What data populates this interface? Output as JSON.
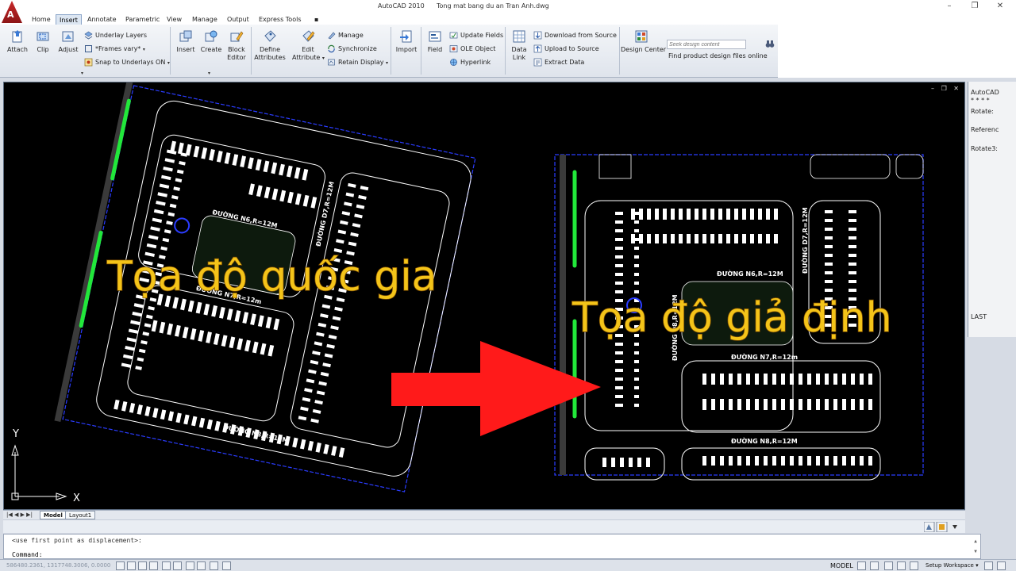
{
  "window": {
    "title": "AutoCAD 2010      Tong mat bang du an Tran Anh.dwg",
    "minimize": "–",
    "restore": "❐",
    "close": "✕",
    "logo_letter": "A"
  },
  "tabs": [
    {
      "label": "Home"
    },
    {
      "label": "Insert"
    },
    {
      "label": "Annotate"
    },
    {
      "label": "Parametric"
    },
    {
      "label": "View"
    },
    {
      "label": "Manage"
    },
    {
      "label": "Output"
    },
    {
      "label": "Express Tools"
    },
    {
      "label": "▪"
    }
  ],
  "active_tab": "Insert",
  "ribbon": {
    "attach": "Attach",
    "clip": "Clip",
    "adjust": "Adjust",
    "underlay_layers": "Underlay Layers",
    "frames_vary": "*Frames vary*",
    "snap_to_underlays": "Snap to Underlays ON",
    "insert": "Insert",
    "create": "Create",
    "block_editor_1": "Block",
    "block_editor_2": "Editor",
    "define_attributes_1": "Define",
    "define_attributes_2": "Attributes",
    "edit_attribute_1": "Edit",
    "edit_attribute_2": "Attribute",
    "manage": "Manage",
    "synchronize": "Synchronize",
    "retain_display": "Retain Display",
    "import": "Import",
    "field": "Field",
    "update_fields": "Update Fields",
    "ole_object": "OLE Object",
    "hyperlink": "Hyperlink",
    "data_link_1": "Data",
    "data_link_2": "Link",
    "download_from_source": "Download from Source",
    "upload_to_source": "Upload to Source",
    "extract_data": "Extract  Data",
    "design_center": "Design Center",
    "search_placeholder": "Seek design content",
    "find_online": "Find product design files online",
    "dropdown_arrow": "▾"
  },
  "drawing": {
    "left_caption": "Tọa độ quốc gia",
    "right_caption": "Tọa độ giả định",
    "road_n6": "ĐƯỜNG N6,R=12M",
    "road_n7": "ĐƯỜNG N7,R=12m",
    "road_n8": "ĐƯỜNG N8,R=12M",
    "road_d7": "ĐƯỜNG D7,R=12M",
    "road_d8": "ĐƯỜNG D8,R=12M",
    "ucs_y": "Y",
    "ucs_x": "X",
    "colors": {
      "caption_fill": "#f4c419",
      "caption_stroke": "#8a5a00",
      "arrow": "#ff1a1a",
      "green_line": "#22e83a",
      "boundary": "#2a3cff",
      "road": "#ffffff",
      "lot": "#ffffff"
    }
  },
  "viewport_controls": "– ❐ ✕",
  "palette": {
    "title": "AutoCAD",
    "stars": "* * * *",
    "rotate": "Rotate:",
    "reference": "Referenc",
    "rotate3": "Rotate3:",
    "last": "LAST"
  },
  "layout_tabs": [
    {
      "label": "Model"
    },
    {
      "label": "Layout1"
    }
  ],
  "nav_arrows": "|◀ ◀ ▶ ▶|",
  "command": {
    "previous": "<use first point as displacement>:",
    "prompt": "Command:",
    "scroll_up": "▲",
    "scroll_down": "▼"
  },
  "status": {
    "coords": "586480.2361, 1317748.3006, 0.0000",
    "model": "MODEL",
    "workspace": "Setup Workspace ▾"
  }
}
